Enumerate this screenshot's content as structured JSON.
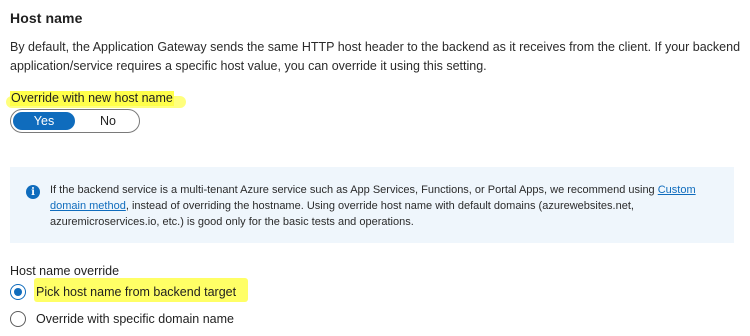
{
  "section": {
    "title": "Host name",
    "description": "By default, the Application Gateway sends the same HTTP host header to the backend as it receives from the client. If your backend application/service requires a specific host value, you can override it using this setting."
  },
  "override_toggle": {
    "label": "Override with new host name",
    "options": [
      "Yes",
      "No"
    ],
    "selected": "Yes"
  },
  "info": {
    "icon": "info-icon",
    "text_before": "If the backend service is a multi-tenant Azure service such as App Services, Functions, or Portal Apps, we recommend using ",
    "link_text": "Custom domain method",
    "text_after": ", instead of overriding the hostname. Using override host name with default domains (azurewebsites.net, azuremicroservices.io, etc.) is good only for the basic tests and operations."
  },
  "host_name_override": {
    "label": "Host name override",
    "options": [
      "Pick host name from backend target",
      "Override with specific domain name"
    ],
    "selected": "Pick host name from backend target"
  },
  "colors": {
    "accent": "#0f6cbd",
    "info_background": "#eff6fc",
    "highlight": "#ffff33"
  }
}
